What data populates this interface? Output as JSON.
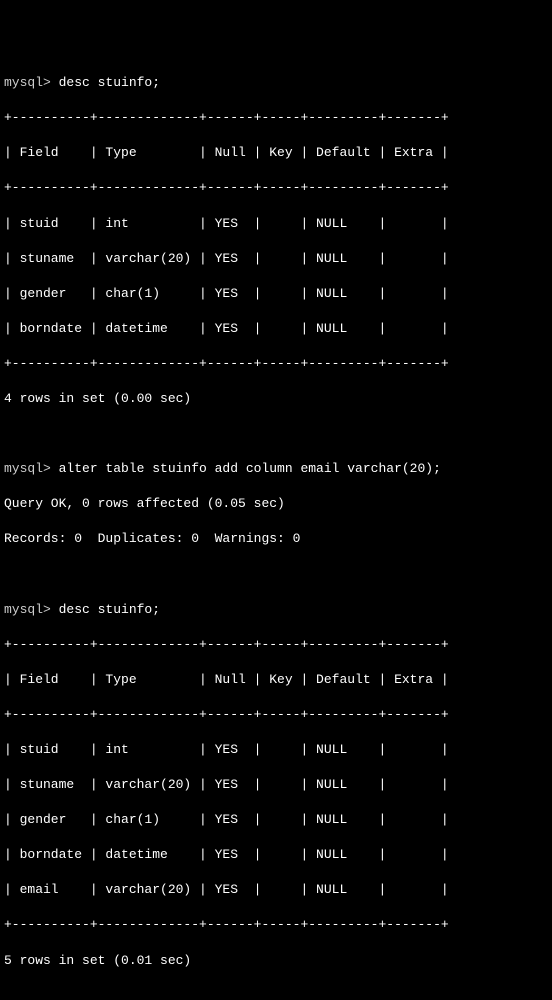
{
  "session": {
    "prompt": "mysql> ",
    "cmd1": "desc stuinfo;",
    "cmd2": "alter table stuinfo add column email varchar(20);",
    "cmd3": "desc stuinfo;",
    "query_ok": "Query OK, 0 rows affected (0.05 sec)",
    "records_line": "Records: 0  Duplicates: 0  Warnings: 0",
    "table1_summary": "4 rows in set (0.00 sec)",
    "table2_summary": "5 rows in set (0.01 sec)"
  },
  "border": {
    "sep": "+----------+-------------+------+-----+---------+-------+",
    "header": "| Field    | Type        | Null | Key | Default | Extra |"
  },
  "table1": {
    "rows": [
      "| stuid    | int         | YES  |     | NULL    |       |",
      "| stuname  | varchar(20) | YES  |     | NULL    |       |",
      "| gender   | char(1)     | YES  |     | NULL    |       |",
      "| borndate | datetime    | YES  |     | NULL    |       |"
    ],
    "columns": [
      "Field",
      "Type",
      "Null",
      "Key",
      "Default",
      "Extra"
    ],
    "data": [
      {
        "Field": "stuid",
        "Type": "int",
        "Null": "YES",
        "Key": "",
        "Default": "NULL",
        "Extra": ""
      },
      {
        "Field": "stuname",
        "Type": "varchar(20)",
        "Null": "YES",
        "Key": "",
        "Default": "NULL",
        "Extra": ""
      },
      {
        "Field": "gender",
        "Type": "char(1)",
        "Null": "YES",
        "Key": "",
        "Default": "NULL",
        "Extra": ""
      },
      {
        "Field": "borndate",
        "Type": "datetime",
        "Null": "YES",
        "Key": "",
        "Default": "NULL",
        "Extra": ""
      }
    ]
  },
  "table2": {
    "rows": [
      "| stuid    | int         | YES  |     | NULL    |       |",
      "| stuname  | varchar(20) | YES  |     | NULL    |       |",
      "| gender   | char(1)     | YES  |     | NULL    |       |",
      "| borndate | datetime    | YES  |     | NULL    |       |",
      "| email    | varchar(20) | YES  |     | NULL    |       |"
    ],
    "columns": [
      "Field",
      "Type",
      "Null",
      "Key",
      "Default",
      "Extra"
    ],
    "data": [
      {
        "Field": "stuid",
        "Type": "int",
        "Null": "YES",
        "Key": "",
        "Default": "NULL",
        "Extra": ""
      },
      {
        "Field": "stuname",
        "Type": "varchar(20)",
        "Null": "YES",
        "Key": "",
        "Default": "NULL",
        "Extra": ""
      },
      {
        "Field": "gender",
        "Type": "char(1)",
        "Null": "YES",
        "Key": "",
        "Default": "NULL",
        "Extra": ""
      },
      {
        "Field": "borndate",
        "Type": "datetime",
        "Null": "YES",
        "Key": "",
        "Default": "NULL",
        "Extra": ""
      },
      {
        "Field": "email",
        "Type": "varchar(20)",
        "Null": "YES",
        "Key": "",
        "Default": "NULL",
        "Extra": ""
      }
    ]
  }
}
